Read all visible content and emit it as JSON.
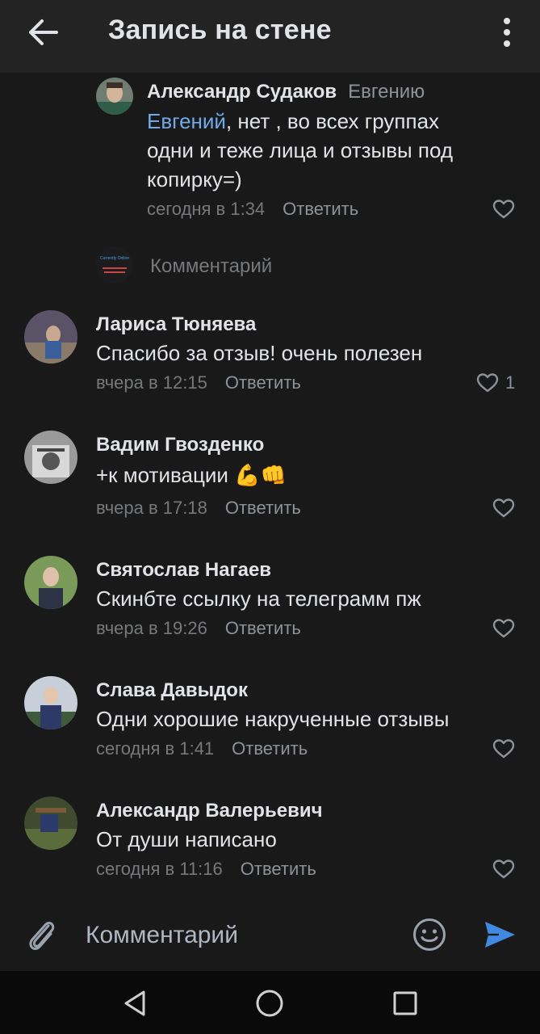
{
  "header": {
    "title": "Запись на стене"
  },
  "reply_comment": {
    "author": "Александр Судаков",
    "reply_to": "Евгению",
    "mention": "Евгений",
    "text_line1": ", нет , во всех группах",
    "text_line2": "одни и теже лица и отзывы под",
    "text_line3": "копирку=)",
    "time": "сегодня в 1:34",
    "reply_label": "Ответить"
  },
  "inline_composer": {
    "avatar_text": "Currently Online",
    "placeholder": "Комментарий"
  },
  "comments": [
    {
      "author": "Лариса Тюняева",
      "text": "Спасибо за отзыв! очень полезен",
      "time": "вчера в 12:15",
      "reply_label": "Ответить",
      "likes": "1"
    },
    {
      "author": "Вадим Гвозденко",
      "text": "+к мотивации 💪👊",
      "time": "вчера в 17:18",
      "reply_label": "Ответить"
    },
    {
      "author": "Святослав Нагаев",
      "text": "Скинбте ссылку на телеграмм пж",
      "time": "вчера в 19:26",
      "reply_label": "Ответить"
    },
    {
      "author": "Слава Давыдок",
      "text": "Одни хорошие накрученные отзывы",
      "time": "сегодня в 1:41",
      "reply_label": "Ответить"
    },
    {
      "author": "Александр Валерьевич",
      "text": "От души написано",
      "time": "сегодня в 11:16",
      "reply_label": "Ответить"
    }
  ],
  "composer": {
    "placeholder": "Комментарий"
  },
  "icons": {
    "back": "arrow-left-icon",
    "more": "vertical-dots-icon",
    "heart": "heart-outline-icon",
    "attach": "paperclip-icon",
    "emoji": "smiley-icon",
    "send": "send-arrow-icon",
    "nav_back": "triangle-back-icon",
    "nav_home": "circle-home-icon",
    "nav_recent": "square-recents-icon"
  },
  "colors": {
    "background": "#19191a",
    "header": "#232324",
    "link": "#71aaeb",
    "secondary_text": "#76787a",
    "send": "#3f8ae0"
  }
}
